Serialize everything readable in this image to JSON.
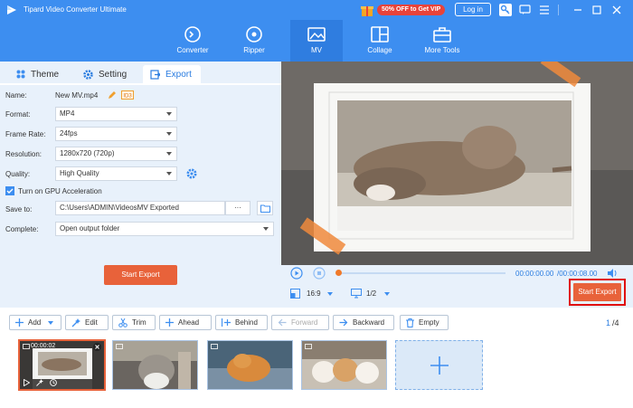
{
  "app": {
    "title": "Tipard Video Converter Ultimate",
    "promo": "50% OFF to Get VIP",
    "login": "Log in"
  },
  "nav": [
    {
      "label": "Converter",
      "icon": "converter-icon"
    },
    {
      "label": "Ripper",
      "icon": "ripper-icon"
    },
    {
      "label": "MV",
      "icon": "mv-icon",
      "active": true
    },
    {
      "label": "Collage",
      "icon": "collage-icon"
    },
    {
      "label": "More Tools",
      "icon": "toolbox-icon"
    }
  ],
  "tabs": {
    "theme": "Theme",
    "setting": "Setting",
    "export": "Export"
  },
  "export": {
    "name_label": "Name:",
    "name_value": "New MV.mp4",
    "format_label": "Format:",
    "format_value": "MP4",
    "framerate_label": "Frame Rate:",
    "framerate_value": "24fps",
    "resolution_label": "Resolution:",
    "resolution_value": "1280x720 (720p)",
    "quality_label": "Quality:",
    "quality_value": "High Quality",
    "gpu_label": "Turn on GPU Acceleration",
    "gpu_checked": true,
    "saveto_label": "Save to:",
    "saveto_value": "C:\\Users\\ADMIN\\VideosMV Exported",
    "saveto_more": "···",
    "complete_label": "Complete:",
    "complete_value": "Open output folder",
    "start_label": "Start Export"
  },
  "player": {
    "time_current": "00:00:00.00",
    "time_total": "/00:00:08.00",
    "aspect": "16:9",
    "page": "1/2",
    "start_export": "Start Export"
  },
  "toolbar": {
    "add": "Add",
    "edit": "Edit",
    "trim": "Trim",
    "ahead": "Ahead",
    "behind": "Behind",
    "forward": "Forward",
    "backward": "Backward",
    "empty": "Empty",
    "page_current": "1",
    "page_total": "/4"
  },
  "thumbs": [
    {
      "duration": "00:00:02"
    },
    {},
    {},
    {}
  ],
  "colors": {
    "brand_blue": "#3d8ef0",
    "accent_orange": "#e8623a",
    "highlight_red": "#e01010"
  }
}
